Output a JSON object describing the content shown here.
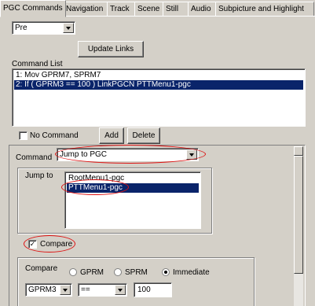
{
  "tabs": [
    {
      "label": "PGC Commands"
    },
    {
      "label": "Navigation"
    },
    {
      "label": "Track"
    },
    {
      "label": "Scene"
    },
    {
      "label": "Still"
    },
    {
      "label": "Audio"
    },
    {
      "label": "Subpicture and Highlight"
    }
  ],
  "pre_select": {
    "value": "Pre"
  },
  "update_links_label": "Update Links",
  "command_list": {
    "label": "Command List",
    "items": [
      {
        "text": "1: Mov GPRM7, SPRM7"
      },
      {
        "text": "2: If ( GPRM3 == 100 ) LinkPGCN PTTMenu1-pgc"
      }
    ]
  },
  "no_command_label": "No Command",
  "add_label": "Add",
  "delete_label": "Delete",
  "command": {
    "label": "Command",
    "value": "Jump to PGC"
  },
  "jump_to": {
    "label": "Jump to",
    "items": [
      {
        "text": "RootMenu1-pgc"
      },
      {
        "text": "PTTMenu1-pgc"
      }
    ]
  },
  "compare_checkbox": {
    "label": "Compare",
    "checked": "✓"
  },
  "compare_group": {
    "label": "Compare",
    "radios": [
      {
        "label": "GPRM"
      },
      {
        "label": "SPRM"
      },
      {
        "label": "Immediate"
      }
    ],
    "left_select": "GPRM3",
    "op_select": "==",
    "value": "100"
  },
  "colors": {
    "face": "#d4d0c8",
    "selection": "#0a246a",
    "annotation": "#dd1111"
  }
}
